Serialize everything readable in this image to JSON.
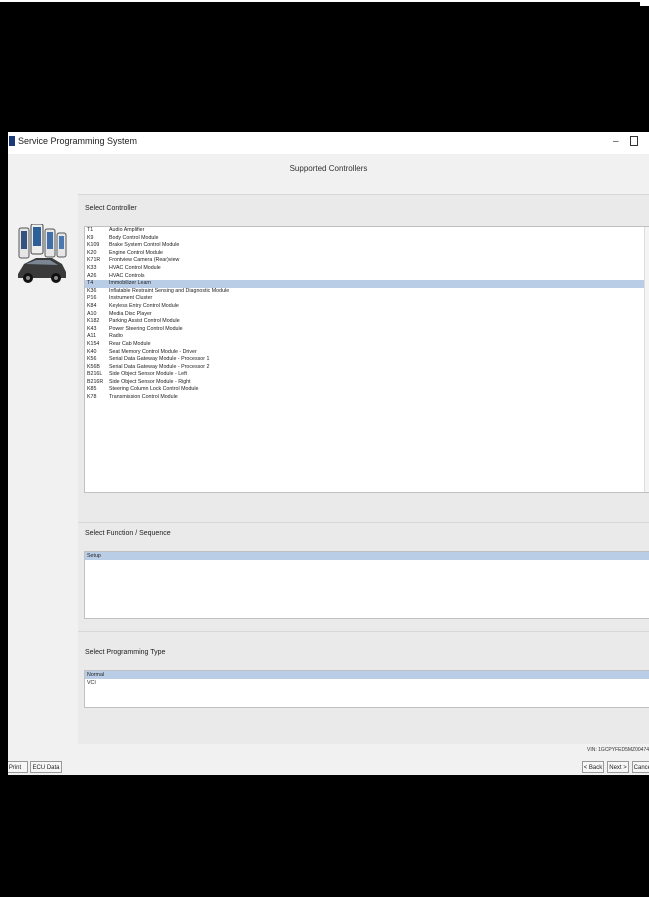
{
  "window": {
    "title": "Service Programming System",
    "minimize_glyph": "–",
    "icon": "app-icon"
  },
  "heading": "Supported Controllers",
  "panels": {
    "controller": {
      "label": "Select Controller",
      "items": [
        {
          "code": "T1",
          "desc": "Audio Amplifier"
        },
        {
          "code": "K9",
          "desc": "Body Control Module"
        },
        {
          "code": "K109",
          "desc": "Brake System Control Module"
        },
        {
          "code": "K20",
          "desc": "Engine Control Module"
        },
        {
          "code": "K71R",
          "desc": "Frontview Camera (Rear)view"
        },
        {
          "code": "K33",
          "desc": "HVAC Control Module"
        },
        {
          "code": "A26",
          "desc": "HVAC Controls"
        },
        {
          "code": "T4",
          "desc": "Immobilizer Learn"
        },
        {
          "code": "K36",
          "desc": "Inflatable Restraint Sensing and Diagnostic Module"
        },
        {
          "code": "P16",
          "desc": "Instrument Cluster"
        },
        {
          "code": "K84",
          "desc": "Keyless Entry Control Module"
        },
        {
          "code": "A10",
          "desc": "Media Disc Player"
        },
        {
          "code": "K182",
          "desc": "Parking Assist Control Module"
        },
        {
          "code": "K43",
          "desc": "Power Steering Control Module"
        },
        {
          "code": "A11",
          "desc": "Radio"
        },
        {
          "code": "K154",
          "desc": "Rear Cab Module"
        },
        {
          "code": "K40",
          "desc": "Seat Memory Control Module - Driver"
        },
        {
          "code": "K56",
          "desc": "Serial Data Gateway Module - Processor 1"
        },
        {
          "code": "K56B",
          "desc": "Serial Data Gateway Module - Processor 2"
        },
        {
          "code": "B216L",
          "desc": "Side Object Sensor Module - Left"
        },
        {
          "code": "B216R",
          "desc": "Side Object Sensor Module - Right"
        },
        {
          "code": "K85",
          "desc": "Steering Column Lock Control Module"
        },
        {
          "code": "K78",
          "desc": "Transmission Control Module"
        }
      ],
      "selected_index": 7
    },
    "sequence": {
      "label": "Select Function / Sequence",
      "items": [
        "Setup"
      ],
      "selected_index": 0
    },
    "programming_type": {
      "label": "Select Programming Type",
      "items": [
        "Normal",
        "VCI"
      ],
      "selected_index": 0
    }
  },
  "bottom": {
    "vin": "VIN: 1GCPYFED5MZ00474",
    "buttons": {
      "print": "Print",
      "ecu_data": "ECU Data",
      "back": "< Back",
      "next": "Next >",
      "cancel": "Cancel"
    }
  },
  "colors": {
    "selection": "#b9cde6",
    "panel_bg": "#eaeaea",
    "window_bg": "#f1f1f1"
  }
}
